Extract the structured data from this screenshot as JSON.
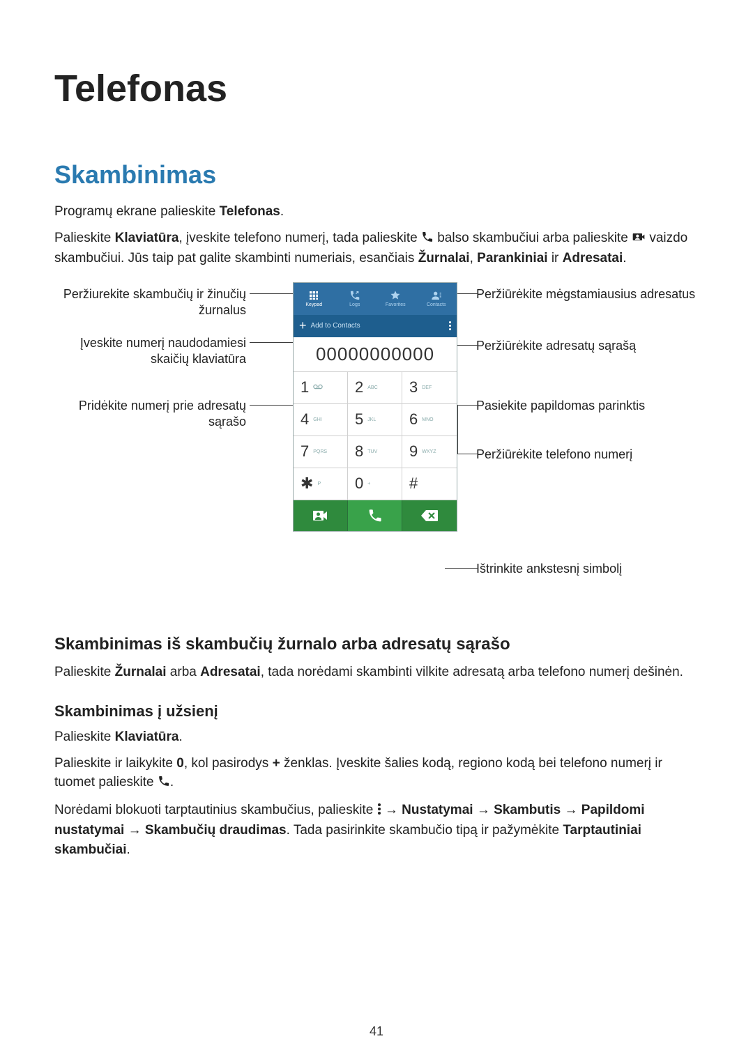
{
  "title": "Telefonas",
  "section1": {
    "heading": "Skambinimas",
    "p1_a": "Programų ekrane palieskite ",
    "p1_b": "Telefonas",
    "p1_c": ".",
    "p2_a": "Palieskite ",
    "p2_b": "Klaviatūra",
    "p2_c": ", įveskite telefono numerį, tada palieskite ",
    "p2_d": " balso skambučiui arba palieskite ",
    "p2_e": " vaizdo skambučiui. Jūs taip pat galite skambinti numeriais, esančiais ",
    "p2_f": "Žurnalai",
    "p2_g": ", ",
    "p2_h": "Parankiniai",
    "p2_i": " ir ",
    "p2_j": "Adresatai",
    "p2_k": "."
  },
  "diagram": {
    "left": {
      "logs": "Peržiurekite skambučių ir žinučių žurnalus",
      "keypad": "Įveskite numerį naudodamiesi skaičių klaviatūra",
      "add": "Pridėkite numerį prie adresatų sąrašo"
    },
    "right": {
      "fav": "Peržiūrėkite mėgstamiausius adresatus",
      "contacts": "Peržiūrėkite adresatų sąrašą",
      "options": "Pasiekite papildomas parinktis",
      "number": "Peržiūrėkite telefono numerį",
      "delete": "Ištrinkite ankstesnį simbolį"
    },
    "phone": {
      "tabs": {
        "keypad": "Keypad",
        "logs": "Logs",
        "fav": "Favorites",
        "contacts": "Contacts"
      },
      "add_label": "Add to Contacts",
      "number": "00000000000",
      "keys": [
        {
          "d": "1",
          "s": ""
        },
        {
          "d": "2",
          "s": "ABC"
        },
        {
          "d": "3",
          "s": "DEF"
        },
        {
          "d": "4",
          "s": "GHI"
        },
        {
          "d": "5",
          "s": "JKL"
        },
        {
          "d": "6",
          "s": "MNO"
        },
        {
          "d": "7",
          "s": "PQRS"
        },
        {
          "d": "8",
          "s": "TUV"
        },
        {
          "d": "9",
          "s": "WXYZ"
        },
        {
          "d": "✱",
          "s": "P"
        },
        {
          "d": "0",
          "s": "+"
        },
        {
          "d": "#",
          "s": ""
        }
      ]
    }
  },
  "section2": {
    "heading": "Skambinimas iš skambučių žurnalo arba adresatų sąrašo",
    "p_a": "Palieskite ",
    "p_b": "Žurnalai",
    "p_c": " arba ",
    "p_d": "Adresatai",
    "p_e": ", tada norėdami skambinti vilkite adresatą arba telefono numerį dešinėn."
  },
  "section3": {
    "heading": "Skambinimas į užsienį",
    "p1_a": "Palieskite ",
    "p1_b": "Klaviatūra",
    "p1_c": ".",
    "p2_a": "Palieskite ir laikykite ",
    "p2_b": "0",
    "p2_c": ", kol pasirodys ",
    "p2_d": "+",
    "p2_e": " ženklas. Įveskite šalies kodą, regiono kodą bei telefono numerį ir tuomet palieskite ",
    "p2_f": ".",
    "p3_a": "Norėdami blokuoti tarptautinius skambučius, palieskite ",
    "p3_b": " → ",
    "p3_c": "Nustatymai",
    "p3_d": " → ",
    "p3_e": "Skambutis",
    "p3_f": " → ",
    "p3_g": "Papildomi nustatymai",
    "p3_h": " → ",
    "p3_i": "Skambučių draudimas",
    "p3_j": ". Tada pasirinkite skambučio tipą ir pažymėkite ",
    "p3_k": "Tarptautiniai skambučiai",
    "p3_l": "."
  },
  "page_number": "41"
}
